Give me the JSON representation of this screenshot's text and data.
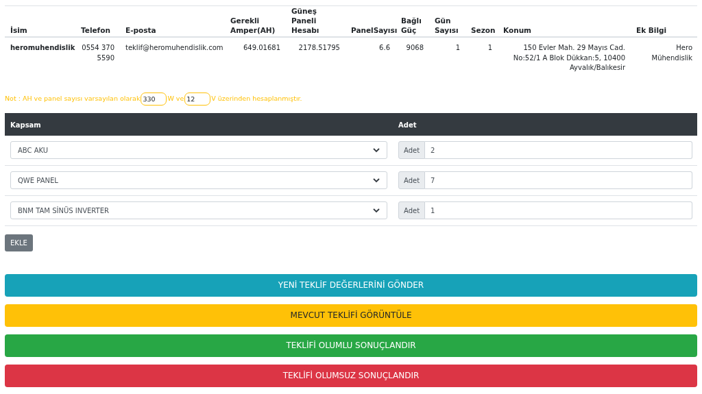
{
  "summary_table": {
    "columns": [
      "İsim",
      "Telefon",
      "E-posta",
      "Gerekli Amper(AH)",
      "Güneş Paneli Hesabı",
      "PanelSayısı",
      "Bağlı Güç",
      "Gün Sayısı",
      "Sezon",
      "Konum",
      "Ek Bilgi"
    ],
    "rows": [
      [
        "heromuhendislik",
        "0554 370 5590",
        "teklif@heromuhendislik.com",
        "649.01681",
        "2178.51795",
        "6.6",
        "9068",
        "1",
        "1",
        "150 Evler Mah. 29 Mayıs Cad. No:52/1 A Blok Dükkan:5, 10400 Ayvalık/Balıkesir",
        "Hero Mühendislik"
      ]
    ]
  },
  "note": {
    "before": "Not : AH ve panel sayısı varsayılan olarak",
    "watt": "330",
    "middle": "W ve",
    "volt": "12",
    "after": "V üzerinden hesaplanmıştır."
  },
  "items_table": {
    "columns": [
      "Kapsam",
      "Adet"
    ],
    "rows": [
      {
        "product": "ABC AKU",
        "addon": "Adet",
        "quantity": "2"
      },
      {
        "product": "QWE PANEL",
        "addon": "Adet",
        "quantity": "7"
      },
      {
        "product": "BNM TAM SİNÜS INVERTER",
        "addon": "Adet",
        "quantity": "1"
      }
    ]
  },
  "add_button": "EKLE",
  "actions": [
    {
      "label": "YENİ TEKLİF DEĞERLERİNİ GÖNDER",
      "kind": "info"
    },
    {
      "label": "MEVCUT TEKLİFİ GÖRÜNTÜLE",
      "kind": "warning"
    },
    {
      "label": "TEKLİFİ OLUMLU SONUÇLANDIR",
      "kind": "success"
    },
    {
      "label": "TEKLİFİ OLUMSUZ SONUÇLANDIR",
      "kind": "danger"
    }
  ]
}
